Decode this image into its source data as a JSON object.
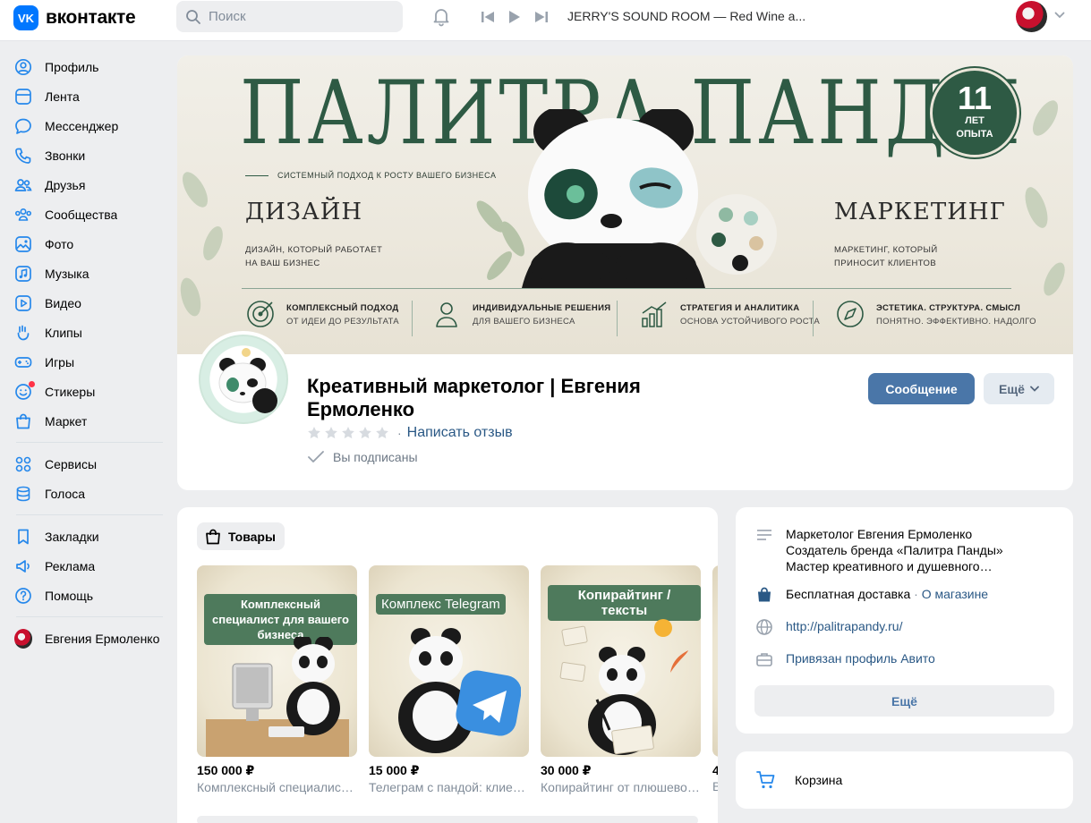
{
  "header": {
    "logo_text": "вконтакте",
    "logo_mark": "VK",
    "search_placeholder": "Поиск",
    "track": "JERRY'S SOUND ROOM — Red Wine a..."
  },
  "sidebar": {
    "items": [
      {
        "label": "Профиль",
        "icon": "user-icon"
      },
      {
        "label": "Лента",
        "icon": "feed-icon"
      },
      {
        "label": "Мессенджер",
        "icon": "chat-icon"
      },
      {
        "label": "Звонки",
        "icon": "phone-icon"
      },
      {
        "label": "Друзья",
        "icon": "friends-icon"
      },
      {
        "label": "Сообщества",
        "icon": "communities-icon"
      },
      {
        "label": "Фото",
        "icon": "photo-icon"
      },
      {
        "label": "Музыка",
        "icon": "music-icon"
      },
      {
        "label": "Видео",
        "icon": "video-icon"
      },
      {
        "label": "Клипы",
        "icon": "clips-icon"
      },
      {
        "label": "Игры",
        "icon": "games-icon"
      },
      {
        "label": "Стикеры",
        "icon": "stickers-icon"
      },
      {
        "label": "Маркет",
        "icon": "market-icon"
      }
    ],
    "items2": [
      {
        "label": "Сервисы",
        "icon": "services-icon"
      },
      {
        "label": "Голоса",
        "icon": "votes-icon"
      }
    ],
    "items3": [
      {
        "label": "Закладки",
        "icon": "bookmark-icon"
      },
      {
        "label": "Реклама",
        "icon": "ads-icon"
      },
      {
        "label": "Помощь",
        "icon": "help-icon"
      }
    ],
    "user_name": "Евгения Ермоленко"
  },
  "cover": {
    "title": "ПАЛИТРА ПАНДЫ",
    "subtitle": "СИСТЕМНЫЙ ПОДХОД К РОСТУ ВАШЕГО БИЗНЕСА",
    "left_heading": "ДИЗАЙН",
    "left_text_1": "ДИЗАЙН, КОТОРЫЙ РАБОТАЕТ",
    "left_text_2": "НА ВАШ БИЗНЕС",
    "right_heading": "МАРКЕТИНГ",
    "right_text_1": "МАРКЕТИНГ, КОТОРЫЙ",
    "right_text_2": "ПРИНОСИТ КЛИЕНТОВ",
    "badge_num": "11",
    "badge_line1": "ЛЕТ",
    "badge_line2": "ОПЫТА",
    "features": [
      {
        "title": "КОМПЛЕКСНЫЙ ПОДХОД",
        "sub": "ОТ ИДЕИ ДО РЕЗУЛЬТАТА"
      },
      {
        "title": "ИНДИВИДУАЛЬНЫЕ РЕШЕНИЯ",
        "sub": "ДЛЯ ВАШЕГО БИЗНЕСА"
      },
      {
        "title": "СТРАТЕГИЯ И АНАЛИТИКА",
        "sub": "ОСНОВА УСТОЙЧИВОГО РОСТА"
      },
      {
        "title": "ЭСТЕТИКА. СТРУКТУРА. СМЫСЛ",
        "sub": "ПОНЯТНО. ЭФФЕКТИВНО. НАДОЛГО"
      }
    ]
  },
  "profile": {
    "name": "Креативный маркетолог | Евгения Ермоленко",
    "rating": 0,
    "review_link": "Написать отзыв",
    "subscribed": "Вы подписаны",
    "message_button": "Сообщение",
    "more_button": "Ещё"
  },
  "products": {
    "chip_label": "Товары",
    "items": [
      {
        "tag": "Комплексный специалист для вашего бизнеса",
        "price": "150 000 ₽",
        "desc": "Комплексный специалист для вашего бизнеса"
      },
      {
        "tag": "Комплекс Telegram",
        "price": "15 000 ₽",
        "desc": "Телеграм с пандой: клиенты"
      },
      {
        "tag": "Копирайтинг / тексты",
        "price": "30 000 ₽",
        "desc": "Копирайтинг от плюшевой панды"
      },
      {
        "tag": "",
        "price": "4",
        "desc": "В"
      }
    ]
  },
  "info": {
    "about_1": "Маркетолог Евгения Ермоленко",
    "about_2": "Создатель бренда «Палитра Панды»",
    "about_3": "Мастер креативного и душевного…",
    "delivery": "Бесплатная доставка",
    "delivery_sep": "·",
    "delivery_link": "О магазине",
    "site": "http://palitrapandy.ru/",
    "avito": "Привязан профиль Авито",
    "more_button": "Ещё"
  },
  "cart": {
    "label": "Корзина"
  },
  "colors": {
    "accent": "#4a76a8",
    "vk_blue": "#0077ff",
    "brand_green": "#2e5a44",
    "link": "#2a5885"
  }
}
